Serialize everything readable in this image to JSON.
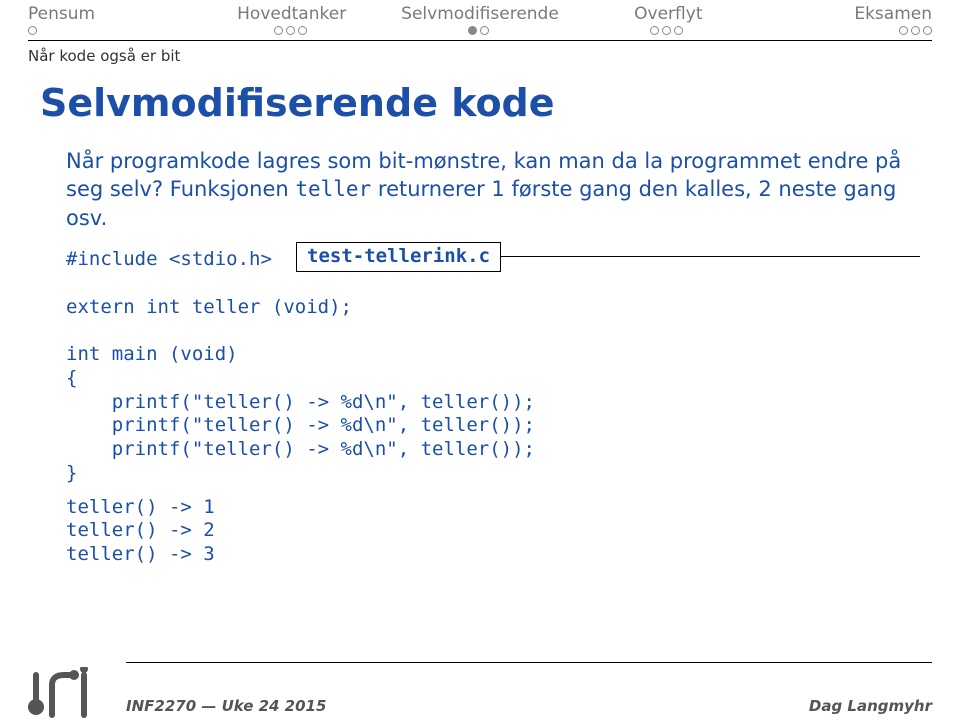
{
  "nav": {
    "items": [
      {
        "label": "Pensum",
        "dots": 1,
        "active": -1
      },
      {
        "label": "Hovedtanker",
        "dots": 3,
        "active": -1
      },
      {
        "label": "Selvmodifiserende",
        "dots": 2,
        "active": 0
      },
      {
        "label": "Overflyt",
        "dots": 3,
        "active": -1
      },
      {
        "label": "Eksamen",
        "dots": 3,
        "active": -1
      }
    ]
  },
  "subtitle": "Når kode også er bit",
  "title": "Selvmodifiserende kode",
  "body": {
    "p1a": "Når programkode lagres som bit-mønstre, kan man da la programmet endre på seg selv? Funksjonen ",
    "p1_code": "teller",
    "p1b": " returnerer 1 første gang den kalles, 2 neste gang osv."
  },
  "code": {
    "filename": "test-tellerink.c",
    "text": "#include <stdio.h>\n\nextern int teller (void);\n\nint main (void)\n{\n    printf(\"teller() -> %d\\n\", teller());\n    printf(\"teller() -> %d\\n\", teller());\n    printf(\"teller() -> %d\\n\", teller());\n}"
  },
  "output": "teller() -> 1\nteller() -> 2\nteller() -> 3",
  "footer": {
    "left": "INF2270 — Uke 24 2015",
    "right": "Dag Langmyhr"
  }
}
